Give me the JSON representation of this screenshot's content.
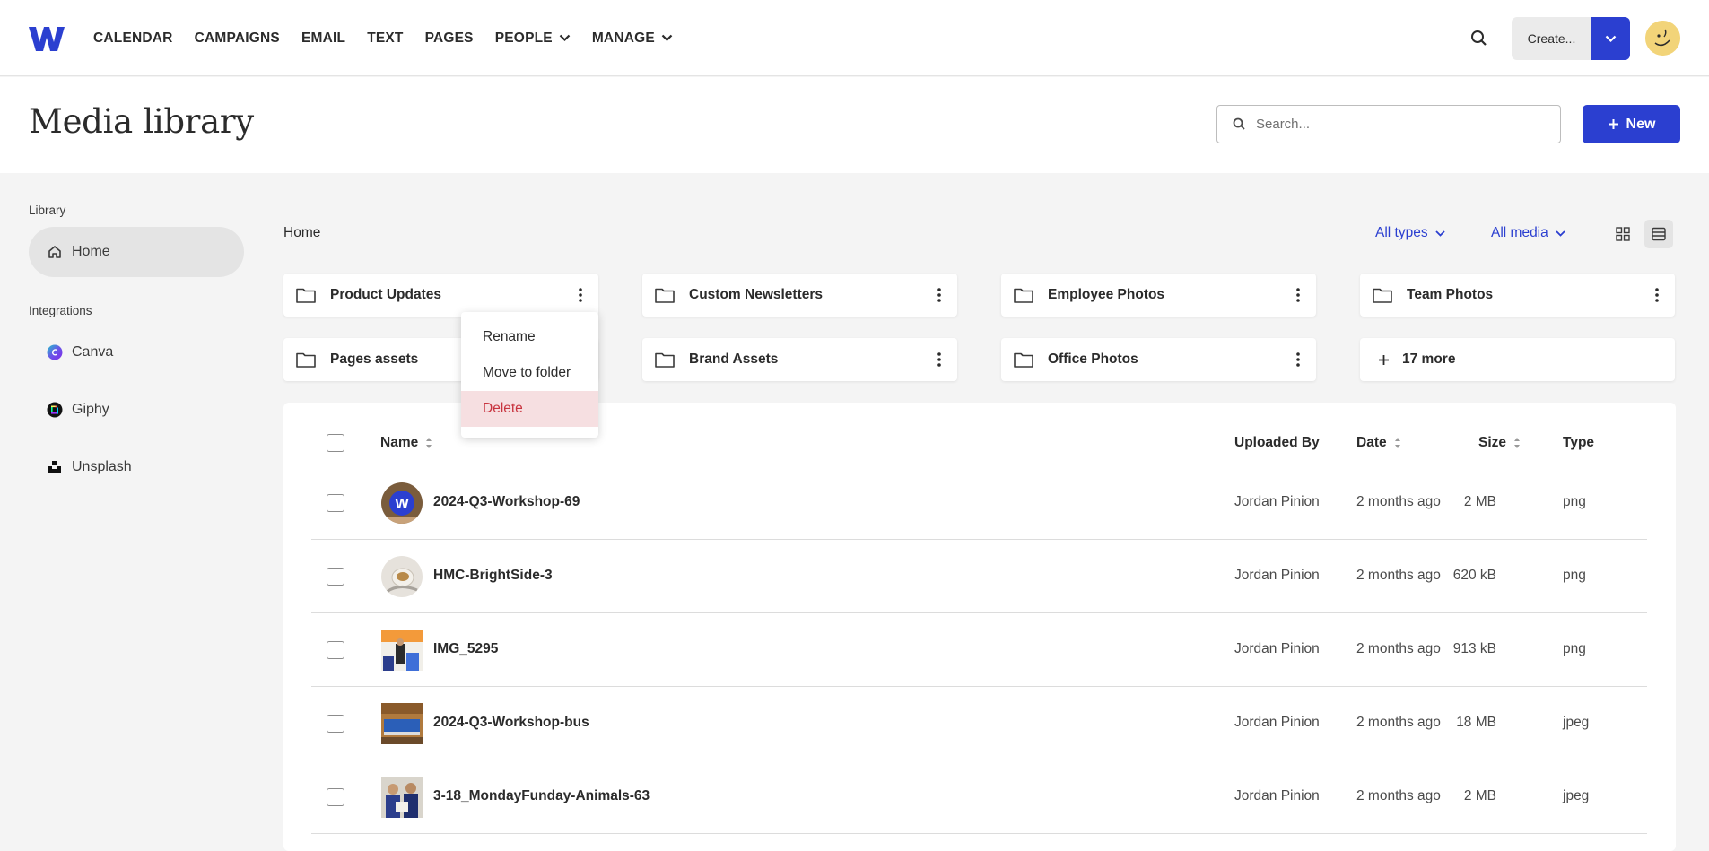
{
  "nav": {
    "items": [
      {
        "label": "CALENDAR",
        "has_dropdown": false
      },
      {
        "label": "CAMPAIGNS",
        "has_dropdown": false
      },
      {
        "label": "EMAIL",
        "has_dropdown": false
      },
      {
        "label": "TEXT",
        "has_dropdown": false
      },
      {
        "label": "PAGES",
        "has_dropdown": false
      },
      {
        "label": "PEOPLE",
        "has_dropdown": true
      },
      {
        "label": "MANAGE",
        "has_dropdown": true
      }
    ],
    "create_label": "Create...",
    "brand_color": "#2b3fd0"
  },
  "header": {
    "title": "Media library",
    "search_placeholder": "Search...",
    "new_label": "New"
  },
  "sidebar": {
    "library_heading": "Library",
    "home_label": "Home",
    "integrations_heading": "Integrations",
    "integrations": [
      {
        "label": "Canva",
        "icon": "canva-icon"
      },
      {
        "label": "Giphy",
        "icon": "giphy-icon"
      },
      {
        "label": "Unsplash",
        "icon": "unsplash-icon"
      }
    ]
  },
  "main": {
    "breadcrumb": "Home",
    "filter_types": "All types",
    "filter_media": "All media",
    "folders": [
      {
        "name": "Product Updates"
      },
      {
        "name": "Custom Newsletters"
      },
      {
        "name": "Employee Photos"
      },
      {
        "name": "Team Photos"
      },
      {
        "name": "Pages assets"
      },
      {
        "name": "Brand Assets"
      },
      {
        "name": "Office Photos"
      }
    ],
    "more_label": "17 more",
    "context_menu": {
      "rename": "Rename",
      "move": "Move to folder",
      "delete": "Delete"
    },
    "table": {
      "columns": {
        "name": "Name",
        "uploaded_by": "Uploaded By",
        "date": "Date",
        "size": "Size",
        "type": "Type"
      },
      "rows": [
        {
          "name": "2024-Q3-Workshop-69",
          "uploaded_by": "Jordan Pinion",
          "date": "2 months ago",
          "size": "2 MB",
          "type": "png"
        },
        {
          "name": "HMC-BrightSide-3",
          "uploaded_by": "Jordan Pinion",
          "date": "2 months ago",
          "size": "620 kB",
          "type": "png"
        },
        {
          "name": "IMG_5295",
          "uploaded_by": "Jordan Pinion",
          "date": "2 months ago",
          "size": "913 kB",
          "type": "png"
        },
        {
          "name": "2024-Q3-Workshop-bus",
          "uploaded_by": "Jordan Pinion",
          "date": "2 months ago",
          "size": "18 MB",
          "type": "jpeg"
        },
        {
          "name": "3-18_MondayFunday-Animals-63",
          "uploaded_by": "Jordan Pinion",
          "date": "2 months ago",
          "size": "2 MB",
          "type": "jpeg"
        }
      ]
    }
  }
}
